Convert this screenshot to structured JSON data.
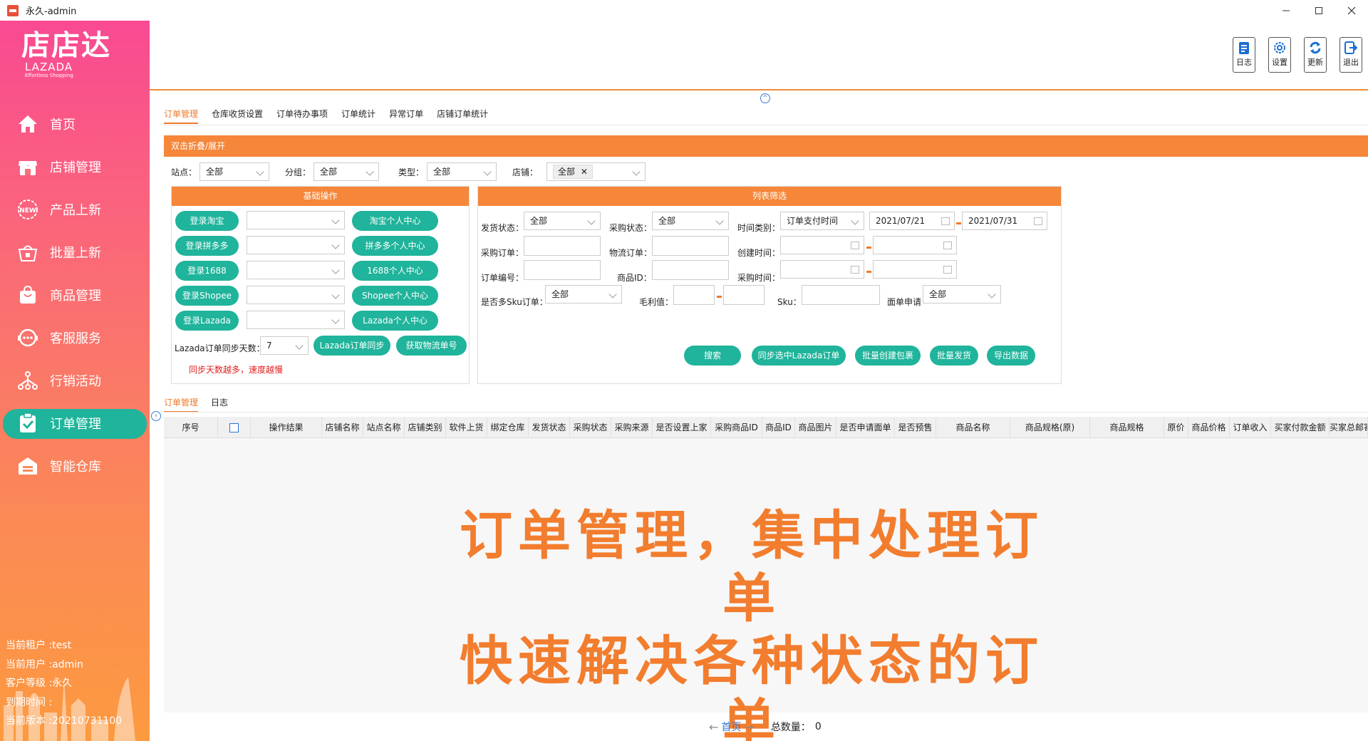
{
  "window": {
    "title": "永久-admin"
  },
  "sidebar": {
    "logo": {
      "main": "店店达",
      "sub": "LAZADA",
      "tagline": "Effortless Shopping"
    },
    "items": [
      {
        "label": "首页",
        "icon": "home-icon"
      },
      {
        "label": "店铺管理",
        "icon": "store-icon"
      },
      {
        "label": "产品上新",
        "icon": "new-badge-icon"
      },
      {
        "label": "批量上新",
        "icon": "basket-icon"
      },
      {
        "label": "商品管理",
        "icon": "shopping-bag-icon"
      },
      {
        "label": "客服服务",
        "icon": "headset-icon"
      },
      {
        "label": "行销活动",
        "icon": "network-icon"
      },
      {
        "label": "订单管理",
        "icon": "clipboard-check-icon"
      },
      {
        "label": "智能仓库",
        "icon": "warehouse-icon"
      }
    ],
    "active_index": 7,
    "userinfo": {
      "tenant": "当前租户 :test",
      "user": "当前用户 :admin",
      "level": "客户等级 :永久",
      "expire": "到期时间 :",
      "version": "当前版本 :20210731100"
    }
  },
  "toolbar": {
    "buttons": [
      {
        "label": "日志",
        "icon": "log-icon"
      },
      {
        "label": "设置",
        "icon": "settings-icon"
      },
      {
        "label": "更新",
        "icon": "refresh-icon"
      },
      {
        "label": "退出",
        "icon": "exit-icon"
      }
    ]
  },
  "tabs": [
    "订单管理",
    "仓库收货设置",
    "订单待办事项",
    "订单统计",
    "异常订单",
    "店铺订单统计"
  ],
  "fold_bar": "双击折叠/展开",
  "filters": {
    "site": {
      "label": "站点：",
      "value": "全部"
    },
    "group": {
      "label": "分组：",
      "value": "全部"
    },
    "type": {
      "label": "类型：",
      "value": "全部"
    },
    "shop": {
      "label": "店铺：",
      "value": "全部"
    }
  },
  "basic_panel": {
    "title": "基础操作",
    "login_buttons": [
      "登录淘宝",
      "登录拼多多",
      "登录1688",
      "登录Shopee",
      "登录Lazada"
    ],
    "center_buttons": [
      "淘宝个人中心",
      "拼多多个人中心",
      "1688个人中心",
      "Shopee个人中心",
      "Lazada个人中心"
    ],
    "sync_days_label": "Lazada订单同步天数：",
    "sync_days_value": "7",
    "sync_button": "Lazada订单同步",
    "tracking_button": "获取物流单号",
    "note": "同步天数越多，速度越慢"
  },
  "list_panel": {
    "title": "列表筛选",
    "ship_status": {
      "label": "发货状态：",
      "value": "全部"
    },
    "purchase_status": {
      "label": "采购状态：",
      "value": "全部"
    },
    "time_type": {
      "label": "时间类别：",
      "value": "订单支付时间"
    },
    "date_from": "2021/07/21",
    "date_to": "2021/07/31",
    "purchase_order_label": "采购订单：",
    "logistics_order_label": "物流订单：",
    "create_time_label": "创建时间：",
    "order_no_label": "订单编号：",
    "product_id_label": "商品ID：",
    "purchase_time_label": "采购时间：",
    "multi_sku": {
      "label": "是否多Sku订单：",
      "value": "全部"
    },
    "margin_label": "毛利值：",
    "sku_label": "Sku：",
    "waybill": {
      "label": "面单申请",
      "value": "全部"
    },
    "buttons": [
      "搜索",
      "同步选中Lazada订单",
      "批量创建包裹",
      "批量发货",
      "导出数据"
    ]
  },
  "bottom_tabs": [
    "订单管理",
    "日志"
  ],
  "grid_columns": [
    "序号",
    "",
    "操作结果",
    "店铺名称",
    "站点名称",
    "店铺类别",
    "软件上货",
    "绑定仓库",
    "发货状态",
    "采购状态",
    "采购来源",
    "是否设置上家",
    "采购商品ID",
    "商品ID",
    "商品图片",
    "是否申请面单",
    "是否预售",
    "商品名称",
    "商品规格(原)",
    "商品规格",
    "原价",
    "商品价格",
    "订单收入",
    "买家付款金额",
    "买家总邮寄费"
  ],
  "overlay": {
    "line1": "订单管理，集中处理订单",
    "line2": "快速解决各种状态的订单"
  },
  "pager": {
    "first": "首页",
    "total_label": "总数量：",
    "total_value": "0"
  },
  "colors": {
    "accent": "#f5863a",
    "green": "#1fb49b",
    "sidebar_top": "#f94a92",
    "sidebar_bottom": "#fc9a40"
  }
}
